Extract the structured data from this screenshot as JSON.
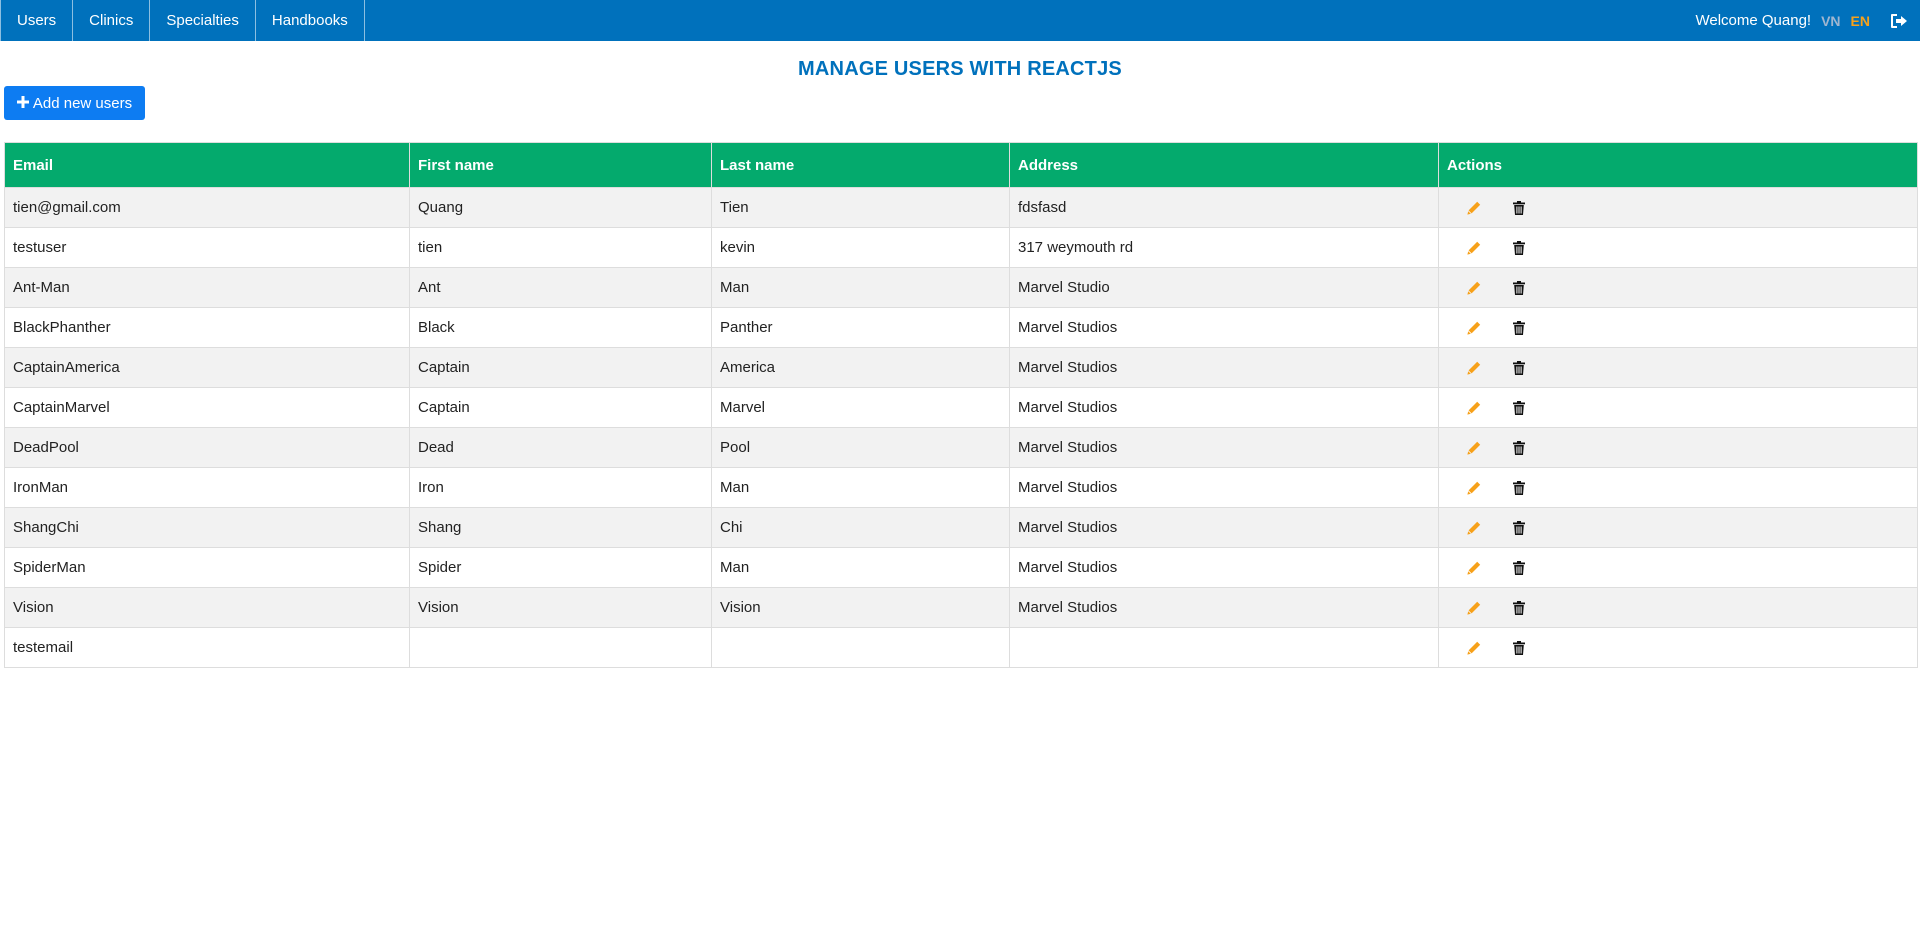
{
  "nav": {
    "items": [
      "Users",
      "Clinics",
      "Specialties",
      "Handbooks"
    ],
    "welcome": "Welcome Quang!",
    "lang_vn": "VN",
    "lang_en": "EN"
  },
  "page": {
    "title": "MANAGE USERS WITH REACTJS",
    "add_button": "Add new users"
  },
  "colors": {
    "topbar": "#0071BC",
    "table_header": "#04AA6D",
    "add_button": "#0d7cf2",
    "edit_icon": "#f7a11a",
    "lang_active": "#f7a11a"
  },
  "icons": {
    "add": "plus-icon",
    "edit": "pencil-icon",
    "delete": "trash-icon",
    "logout": "sign-out-icon"
  },
  "table": {
    "headers": [
      "Email",
      "First name",
      "Last name",
      "Address",
      "Actions"
    ],
    "rows": [
      [
        "tien@gmail.com",
        "Quang",
        "Tien",
        "fdsfasd"
      ],
      [
        "testuser",
        "tien",
        "kevin",
        "317 weymouth rd"
      ],
      [
        "Ant-Man",
        "Ant",
        "Man",
        "Marvel Studio"
      ],
      [
        "BlackPhanther",
        "Black",
        "Panther",
        "Marvel Studios"
      ],
      [
        "CaptainAmerica",
        "Captain",
        "America",
        "Marvel Studios"
      ],
      [
        "CaptainMarvel",
        "Captain",
        "Marvel",
        "Marvel Studios"
      ],
      [
        "DeadPool",
        "Dead",
        "Pool",
        "Marvel Studios"
      ],
      [
        "IronMan",
        "Iron",
        "Man",
        "Marvel Studios"
      ],
      [
        "ShangChi",
        "Shang",
        "Chi",
        "Marvel Studios"
      ],
      [
        "SpiderMan",
        "Spider",
        "Man",
        "Marvel Studios"
      ],
      [
        "Vision",
        "Vision",
        "Vision",
        "Marvel Studios"
      ],
      [
        "testemail",
        "",
        "",
        ""
      ]
    ]
  }
}
